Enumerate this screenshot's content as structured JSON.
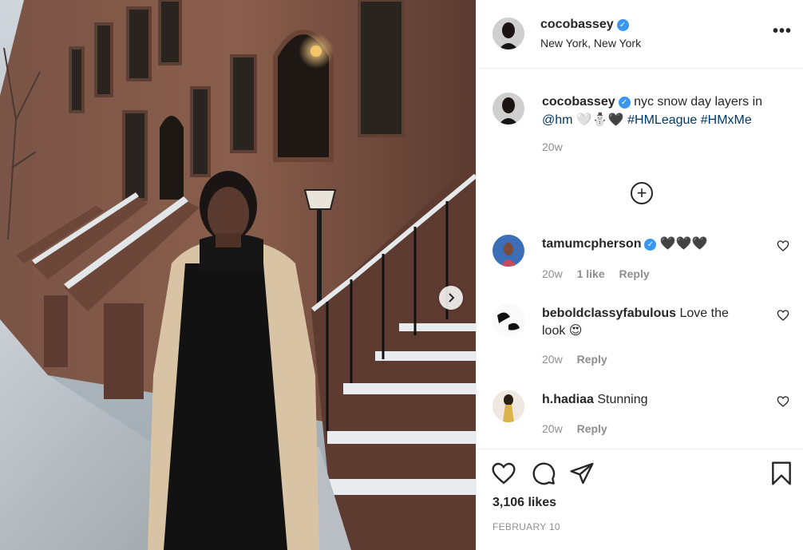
{
  "post": {
    "image_alt": "Woman in beige coat standing on snowy brownstone street",
    "next_icon": "chevron-right-icon"
  },
  "header": {
    "username": "cocobassey",
    "location": "New York, New York",
    "more_icon": "more-options-icon",
    "more_label": "•••"
  },
  "caption": {
    "username": "cocobassey",
    "text": "nyc snow day layers in",
    "mention": "@hm",
    "emojis": "🤍⛄🖤",
    "hashtags": [
      "#HMLeague",
      "#HMxMe"
    ],
    "time": "20w"
  },
  "load_more_label": "+",
  "comments": [
    {
      "username": "tamumcpherson",
      "verified": true,
      "text": "🖤🖤🖤",
      "time": "20w",
      "likes": "1 like",
      "reply": "Reply"
    },
    {
      "username": "beboldclassyfabulous",
      "verified": false,
      "text": "Love the look 😍",
      "time": "20w",
      "likes": "",
      "reply": "Reply"
    },
    {
      "username": "h.hadiaa",
      "verified": false,
      "text": "Stunning",
      "time": "20w",
      "likes": "",
      "reply": "Reply"
    }
  ],
  "footer": {
    "likes": "3,106 likes",
    "date": "FEBRUARY 10"
  },
  "colors": {
    "verified": "#3897f0",
    "link": "#00376b",
    "muted": "#8e8e8e",
    "text": "#262626"
  }
}
